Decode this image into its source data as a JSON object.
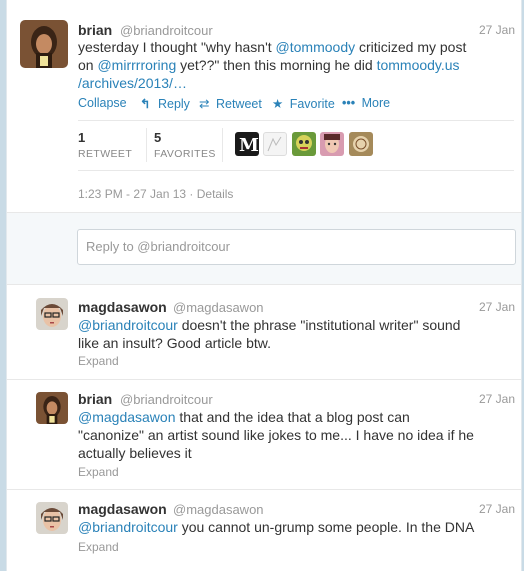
{
  "main_tweet": {
    "name": "brian",
    "handle": "@briandroitcour",
    "date": "27 Jan",
    "text_1": "yesterday I thought \"why hasn't ",
    "mention_1": "@tommoody",
    "text_2": " criticized my post",
    "text_3": "on ",
    "mention_2": "@mirrrroring",
    "text_4": " yet??\" then this morning he did ",
    "link_1": "tommoody.us",
    "link_2": "/archives/2013/…",
    "actions": {
      "collapse": "Collapse",
      "reply": "Reply",
      "retweet": "Retweet",
      "favorite": "Favorite",
      "more": "More"
    },
    "stats": {
      "retweets": "1",
      "retweets_label": "RETWEET",
      "favorites": "5",
      "favorites_label": "FAVORITES"
    },
    "timestamp": "1:23 PM - 27 Jan 13 · Details"
  },
  "reply_box": {
    "placeholder": "Reply to @briandroitcour"
  },
  "replies": [
    {
      "name": "magdasawon",
      "handle": "@magdasawon",
      "date": "27 Jan",
      "mention": "@briandroitcour",
      "line_1": " doesn't the phrase \"institutional writer\" sound",
      "line_2": "like an insult? Good article btw.",
      "expand": "Expand"
    },
    {
      "name": "brian",
      "handle": "@briandroitcour",
      "date": "27 Jan",
      "mention": "@magdasawon",
      "line_1": " that and the idea that a blog post can",
      "line_2": "\"canonize\" an artist sound like jokes to me... I have no idea if he",
      "line_3": "actually believes it",
      "expand": "Expand"
    },
    {
      "name": "magdasawon",
      "handle": "@magdasawon",
      "date": "27 Jan",
      "mention": "@briandroitcour",
      "line_1": " you cannot un-grump some people. In the DNA",
      "expand": "Expand"
    }
  ],
  "colors": {
    "link": "#2a82b8",
    "muted": "#999999",
    "background": "#c9dbe6"
  },
  "icons": [
    "reply-arrow-icon",
    "retweet-icon",
    "star-icon",
    "ellipsis-icon"
  ]
}
